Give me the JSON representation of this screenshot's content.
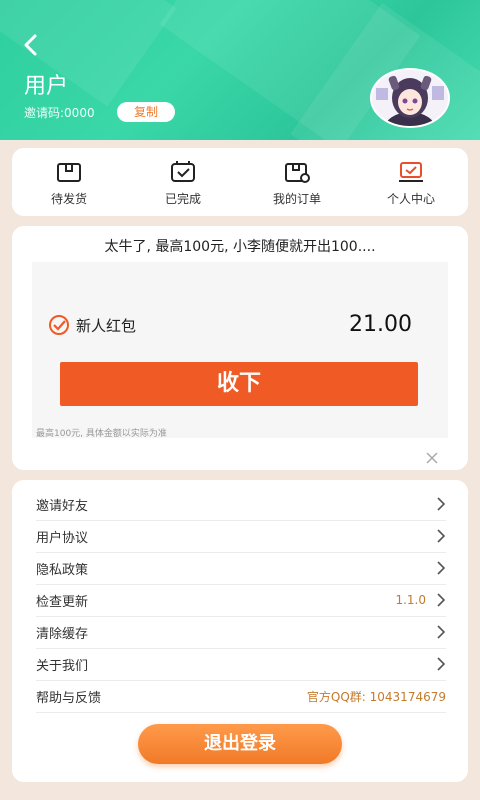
{
  "header": {
    "title": "用户",
    "invite_code": "邀请码:0000",
    "copy_label": "复制"
  },
  "quick_menu": [
    {
      "label": "待发货",
      "icon": "box-icon"
    },
    {
      "label": "已完成",
      "icon": "check-box-icon"
    },
    {
      "label": "我的订单",
      "icon": "order-box-icon"
    },
    {
      "label": "个人中心",
      "icon": "personal-center-icon"
    }
  ],
  "promo": {
    "headline": "太牛了, 最高100元, 小李随便就开出100....",
    "red_packet_label": "新人红包",
    "amount": "21.00",
    "accept_label": "收下",
    "note": "最高100元, 具体金额以实际为准"
  },
  "menu": [
    {
      "label": "邀请好友",
      "value": ""
    },
    {
      "label": "用户协议",
      "value": ""
    },
    {
      "label": "隐私政策",
      "value": ""
    },
    {
      "label": "检查更新",
      "value": "1.1.0"
    },
    {
      "label": "清除缓存",
      "value": ""
    },
    {
      "label": "关于我们",
      "value": ""
    },
    {
      "label": "帮助与反馈",
      "value": "官方QQ群: 1043174679"
    }
  ],
  "logout_label": "退出登录",
  "colors": {
    "header_green": "#2fcf9f",
    "accent_orange": "#f05a24",
    "logout_orange": "#f07a28"
  }
}
